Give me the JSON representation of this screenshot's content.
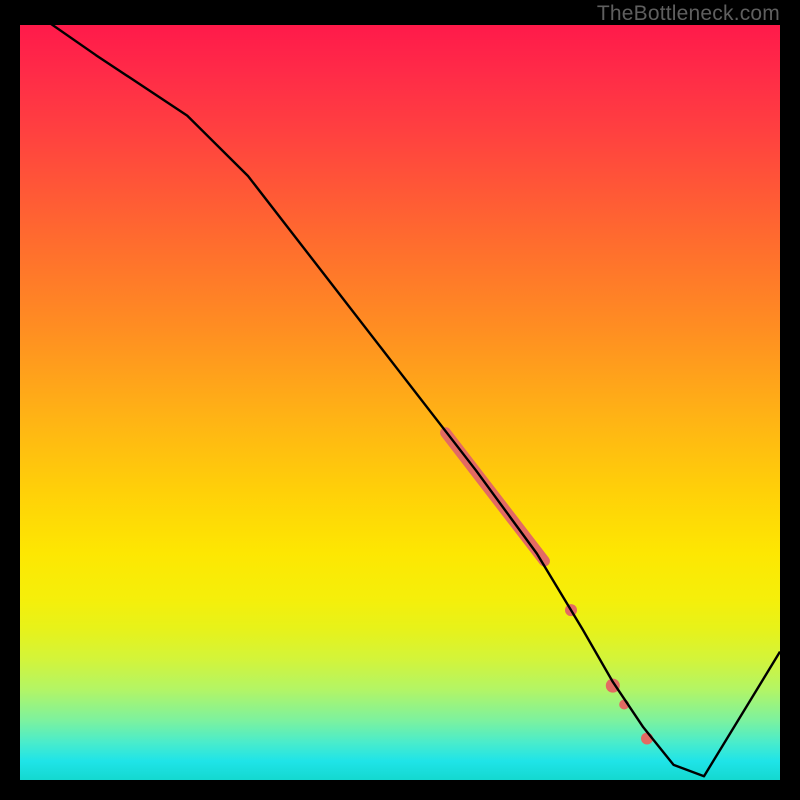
{
  "watermark": {
    "text": "TheBottleneck.com"
  },
  "chart_data": {
    "type": "line",
    "title": "",
    "xlabel": "",
    "ylabel": "",
    "xlim": [
      0,
      100
    ],
    "ylim": [
      0,
      100
    ],
    "grid": false,
    "series": [
      {
        "name": "curve",
        "x": [
          0,
          10,
          22,
          30,
          40,
          50,
          60,
          68,
          74,
          78,
          82,
          86,
          90,
          100
        ],
        "y": [
          103,
          96,
          88,
          80,
          67,
          54,
          41,
          30,
          20,
          13,
          7,
          2,
          0.5,
          17
        ]
      }
    ],
    "highlight_segment": {
      "x": [
        56,
        69
      ],
      "y": [
        46,
        29
      ],
      "color": "#e36a63",
      "width": 11
    },
    "highlight_points": [
      {
        "x": 72.5,
        "y": 22.5,
        "r": 6,
        "color": "#e36a63"
      },
      {
        "x": 78,
        "y": 12.5,
        "r": 7,
        "color": "#e36a63"
      },
      {
        "x": 79.5,
        "y": 10.0,
        "r": 5,
        "color": "#e36a63"
      },
      {
        "x": 82.5,
        "y": 5.5,
        "r": 6,
        "color": "#e36a63"
      }
    ]
  }
}
